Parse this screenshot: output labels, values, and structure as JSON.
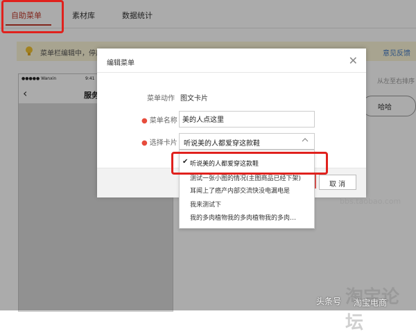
{
  "tabs": [
    {
      "label": "自助菜单",
      "active": true
    },
    {
      "label": "素材库",
      "active": false
    },
    {
      "label": "数据统计",
      "active": false
    }
  ],
  "notice": {
    "text": "菜单栏编辑中，停用",
    "feedback": "意见反馈"
  },
  "phone": {
    "carrier": "●●●●● Wanxin",
    "time": "9:41",
    "title": "服务"
  },
  "right": {
    "hint": "从左至右排序",
    "button": "哈哈"
  },
  "modal": {
    "title": "编辑菜单",
    "action_label": "菜单动作",
    "action_value": "图文卡片",
    "name_label": "菜单名称",
    "name_value": "美的人点这里",
    "card_label": "选择卡片",
    "card_selected": "听说美的人都爱穿这款鞋",
    "cancel": "取 消"
  },
  "dropdown": {
    "items": [
      {
        "label": "听说美的人都爱穿这款鞋",
        "selected": true
      },
      {
        "label": "测试一张小图的情况(主图商品已经下架)",
        "selected": false
      },
      {
        "label": "耳闻上了癌产内部交流快没电漏电是",
        "selected": false
      },
      {
        "label": "我来测试下",
        "selected": false
      },
      {
        "label": "我的多肉植物我的多肉植物我的多肉…",
        "selected": false
      }
    ]
  },
  "watermark": {
    "domain": "bbs.taobao.com",
    "logo": "淘宝论坛",
    "source": "头条号",
    "author": "淘宝电商"
  },
  "colors": {
    "accent_red": "#e0211d",
    "link_blue": "#3f78c4",
    "notice_bg": "#fbf5d7"
  }
}
